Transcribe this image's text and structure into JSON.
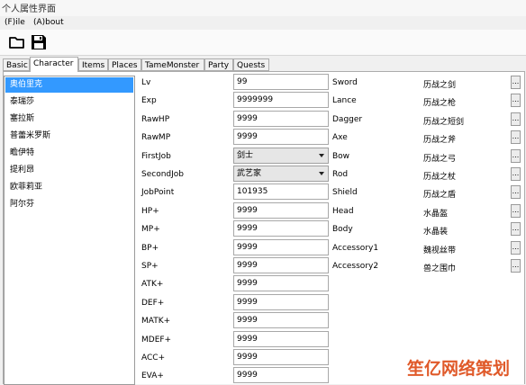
{
  "window": {
    "title": "个人属性界面"
  },
  "menu": {
    "file": "(F)ile",
    "about": "(A)bout"
  },
  "toolbar": {
    "open_icon": "folder-icon",
    "save_icon": "floppy-disk-icon"
  },
  "tabs": [
    {
      "label": "Basic",
      "active": false
    },
    {
      "label": "Character",
      "active": true
    },
    {
      "label": "Items",
      "active": false
    },
    {
      "label": "Places",
      "active": false
    },
    {
      "label": "TameMonster",
      "active": false
    },
    {
      "label": "Party",
      "active": false
    },
    {
      "label": "Quests",
      "active": false
    }
  ],
  "characters": [
    "奥伯里克",
    "泰瑞莎",
    "塞拉斯",
    "普蕾米罗斯",
    "瞻伊特",
    "提利昂",
    "欧菲莉亚",
    "阿尔芬"
  ],
  "selected_character": "奥伯里克",
  "stats": [
    {
      "label": "Lv",
      "value": "99"
    },
    {
      "label": "Exp",
      "value": "9999999"
    },
    {
      "label": "RawHP",
      "value": "9999"
    },
    {
      "label": "RawMP",
      "value": "9999"
    },
    {
      "label": "FirstJob",
      "value": "剑士"
    },
    {
      "label": "SecondJob",
      "value": "武艺家"
    },
    {
      "label": "JobPoint",
      "value": "101935"
    },
    {
      "label": "HP+",
      "value": "9999"
    },
    {
      "label": "MP+",
      "value": "9999"
    },
    {
      "label": "BP+",
      "value": "9999"
    },
    {
      "label": "SP+",
      "value": "9999"
    },
    {
      "label": "ATK+",
      "value": "9999"
    },
    {
      "label": "DEF+",
      "value": "9999"
    },
    {
      "label": "MATK+",
      "value": "9999"
    },
    {
      "label": "MDEF+",
      "value": "9999"
    },
    {
      "label": "ACC+",
      "value": "9999"
    },
    {
      "label": "EVA+",
      "value": "9999"
    }
  ],
  "equipment": [
    {
      "slot": "Sword",
      "item": "历战之剑"
    },
    {
      "slot": "Lance",
      "item": "历战之枪"
    },
    {
      "slot": "Dagger",
      "item": "历战之短剑"
    },
    {
      "slot": "Axe",
      "item": "历战之斧"
    },
    {
      "slot": "Bow",
      "item": "历战之弓"
    },
    {
      "slot": "Rod",
      "item": "历战之杖"
    },
    {
      "slot": "Shield",
      "item": "历战之盾"
    },
    {
      "slot": "Head",
      "item": "水晶盔"
    },
    {
      "slot": "Body",
      "item": "水晶装"
    },
    {
      "slot": "Accessory1",
      "item": "魏视丝带"
    },
    {
      "slot": "Accessory2",
      "item": "兽之围巾"
    }
  ],
  "browse_button_label": "...",
  "watermark": "笙亿网络策划"
}
